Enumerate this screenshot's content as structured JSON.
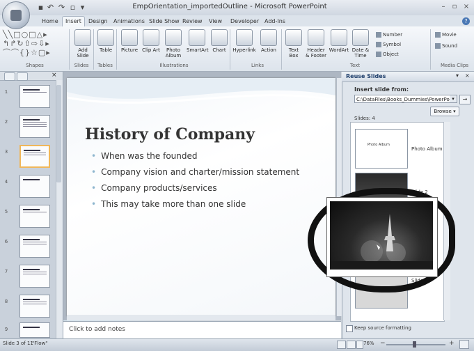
{
  "window": {
    "title": "EmpOrientation_importedOutline - Microsoft PowerPoint"
  },
  "tabs": [
    "Home",
    "Insert",
    "Design",
    "Animations",
    "Slide Show",
    "Review",
    "View",
    "Developer",
    "Add-Ins"
  ],
  "active_tab": "Insert",
  "ribbon": {
    "groups": [
      "Shapes",
      "Slides",
      "Tables",
      "Illustrations",
      "Links",
      "Text",
      "Media Clips"
    ],
    "buttons": {
      "add_slide": "Add Slide",
      "table": "Table",
      "picture": "Picture",
      "clip_art": "Clip Art",
      "photo_album": "Photo Album",
      "smartart": "SmartArt",
      "chart": "Chart",
      "hyperlink": "Hyperlink",
      "action": "Action",
      "text_box": "Text Box",
      "header_footer": "Header & Footer",
      "wordart": "WordArt",
      "date_time": "Date & Time",
      "number": "Number",
      "symbol": "Symbol",
      "object": "Object",
      "movie": "Movie",
      "sound": "Sound"
    }
  },
  "slide_panel": {
    "numbers": [
      "1",
      "2",
      "3",
      "4",
      "5",
      "6",
      "7",
      "8",
      "9"
    ],
    "selected_index": 3
  },
  "slide": {
    "title": "History of Company",
    "bullets": [
      "When was the founded",
      "Company vision and charter/mission statement",
      "Company products/services",
      "This may take more than one slide"
    ]
  },
  "notes": {
    "placeholder": "Click to add notes"
  },
  "task_pane": {
    "title": "Reuse Slides",
    "insert_from_label": "Insert slide from:",
    "path_value": "C:\\DataFiles\\Books_Dummies\\PowerPoint",
    "browse_label": "Browse",
    "slides_count": "Slides: 4",
    "slides": [
      {
        "caption": "Photo Album",
        "thumb_text": "Photo Album"
      },
      {
        "caption": "Slide 2"
      },
      {
        "caption": "Slide 4"
      }
    ],
    "keep_formatting_label": "Keep source formatting"
  },
  "status_bar": {
    "slide_info": "Slide 3 of 11",
    "theme": "\"Flow\"",
    "zoom": "76%"
  },
  "colors": {
    "ribbon_bg": "#dde4ec",
    "accent_selected": "#f0b75a",
    "bullet": "#8fb7cf",
    "pane_title": "#1f3f6b"
  }
}
